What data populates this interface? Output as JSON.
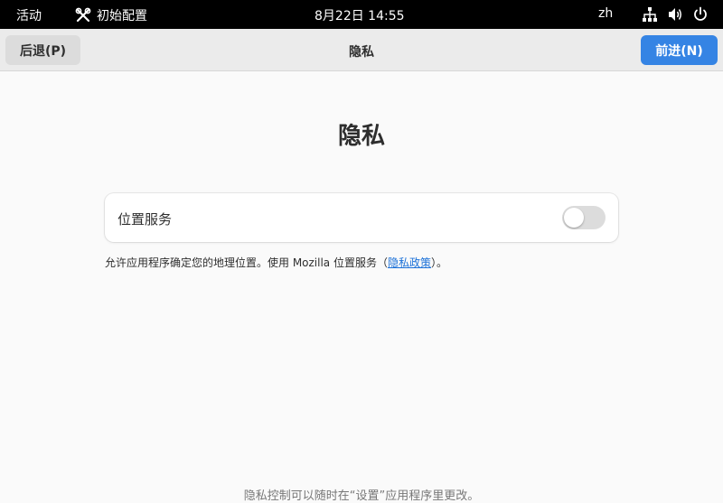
{
  "topbar": {
    "activities": "活动",
    "app_name": "初始配置",
    "clock": "8月22日  14:55",
    "lang": "zh"
  },
  "headerbar": {
    "back_label": "后退(P)",
    "title": "隐私",
    "next_label": "前进(N)"
  },
  "main": {
    "title": "隐私",
    "location_label": "位置服务",
    "location_enabled": false,
    "desc_before": "允许应用程序确定您的地理位置。使用 Mozilla 位置服务（",
    "desc_link": "隐私政策",
    "desc_after": "）。",
    "footer_note": "隐私控制可以随时在“设置”应用程序里更改。"
  },
  "colors": {
    "accent": "#3584e4",
    "topbar_bg": "#000000",
    "link": "#1c71d8"
  },
  "icons": [
    "tools-icon",
    "network-icon",
    "volume-icon",
    "power-icon"
  ]
}
